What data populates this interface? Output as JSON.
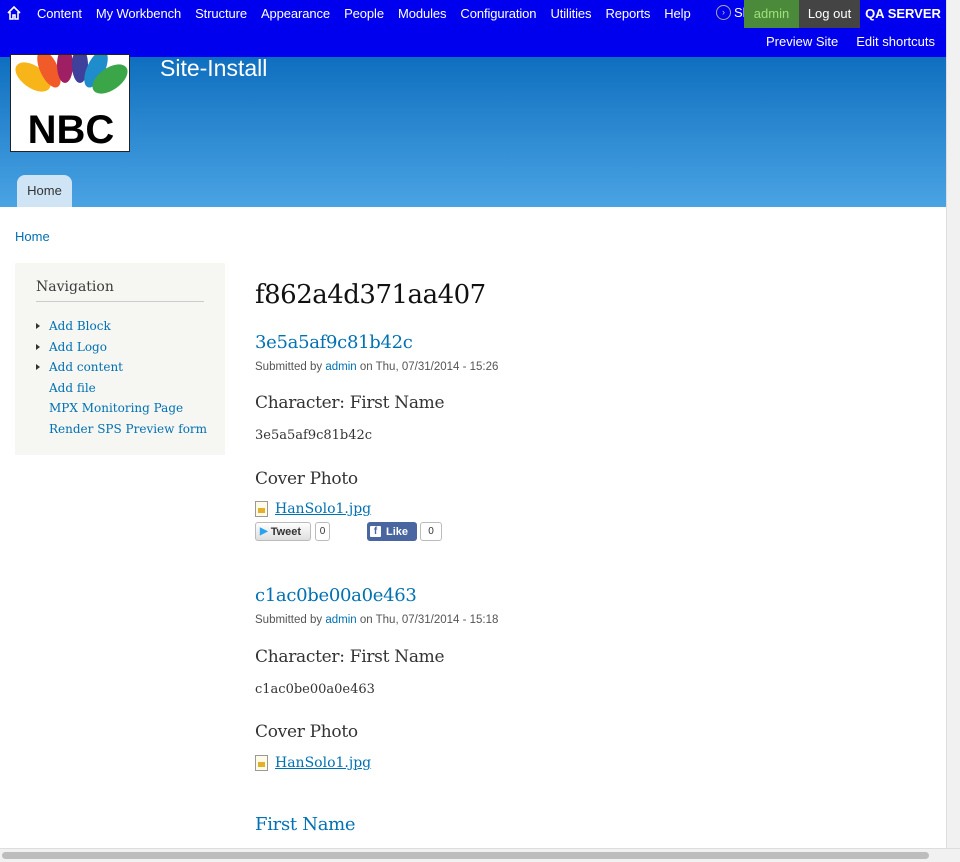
{
  "toolbar": {
    "menu": [
      "Content",
      "My Workbench",
      "Structure",
      "Appearance",
      "People",
      "Modules",
      "Configuration",
      "Utilities",
      "Reports",
      "Help"
    ],
    "shortcuts_label": "Shortcuts",
    "user": "admin",
    "logout": "Log out",
    "server": "QA SERVER",
    "secondary": [
      "Preview Site",
      "Edit shortcuts"
    ]
  },
  "header": {
    "logo_text": "NBC",
    "site_name": "Site-Install",
    "tab_home": "Home"
  },
  "breadcrumb": "Home",
  "sidebar": {
    "title": "Navigation",
    "items": [
      {
        "label": "Add Block",
        "expandable": true
      },
      {
        "label": "Add Logo",
        "expandable": true
      },
      {
        "label": "Add content",
        "expandable": true
      },
      {
        "label": "Add file",
        "expandable": false
      },
      {
        "label": "MPX Monitoring Page",
        "expandable": false
      },
      {
        "label": "Render SPS Preview form",
        "expandable": false
      }
    ]
  },
  "page_title": "f862a4d371aa407",
  "nodes": [
    {
      "title": "3e5a5af9c81b42c",
      "submitted_prefix": "Submitted by",
      "author": "admin",
      "date": "on Thu, 07/31/2014 - 15:26",
      "char_label": "Character: First Name",
      "char_value": "3e5a5af9c81b42c",
      "cover_label": "Cover Photo",
      "file": "HanSolo1.jpg",
      "tweet": "Tweet",
      "tweet_count": "0",
      "like": "Like",
      "like_count": "0"
    },
    {
      "title": "c1ac0be00a0e463",
      "submitted_prefix": "Submitted by",
      "author": "admin",
      "date": "on Thu, 07/31/2014 - 15:18",
      "char_label": "Character: First Name",
      "char_value": "c1ac0be00a0e463",
      "cover_label": "Cover Photo",
      "file": "HanSolo1.jpg"
    },
    {
      "title": "First Name"
    }
  ],
  "colors": {
    "toolbar_bg": "#0000ee",
    "link": "#0071b3",
    "header_gradient_top": "#0f6fbf",
    "header_gradient_bottom": "#4aa3e3"
  }
}
